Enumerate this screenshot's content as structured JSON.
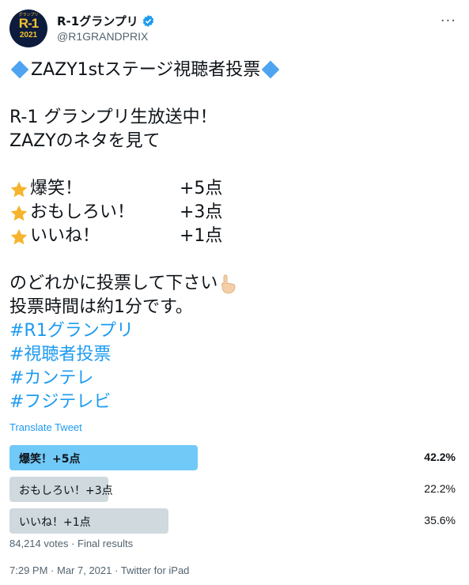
{
  "user": {
    "display_name": "R-1グランプリ",
    "handle": "@R1GRANDPRIX",
    "avatar_text": "R-1",
    "avatar_year": "2021",
    "avatar_top": "グランプリ"
  },
  "tweet": {
    "title": "ZAZY1stステージ視聴者投票",
    "line1": "R-1 グランプリ生放送中！",
    "line2": "ZAZYのネタを見て",
    "scores": [
      {
        "label": "爆笑！",
        "points": "+5点"
      },
      {
        "label": "おもしろい！",
        "points": "+3点"
      },
      {
        "label": "いいね！",
        "points": "+1点"
      }
    ],
    "line3": "のどれかに投票して下さい",
    "line4": "投票時間は約1分です。",
    "hashtags": [
      "#R1グランプリ",
      "#視聴者投票",
      "#カンテレ",
      "#フジテレビ"
    ]
  },
  "translate_label": "Translate Tweet",
  "poll": {
    "options": [
      {
        "label": "爆笑！+5点",
        "percent_text": "42.2%",
        "percent": 42.2,
        "winner": true
      },
      {
        "label": "おもしろい！+3点",
        "percent_text": "22.2%",
        "percent": 22.2,
        "winner": false
      },
      {
        "label": "いいね！+1点",
        "percent_text": "35.6%",
        "percent": 35.6,
        "winner": false
      }
    ],
    "summary": "84,214 votes · Final results"
  },
  "timestamp": {
    "time": "7:29 PM",
    "date": "Mar 7, 2021",
    "source": "Twitter for iPad"
  },
  "colors": {
    "accent": "#1d9bf0",
    "winner_bar": "#71c9f8",
    "other_bar": "#cfd9de",
    "diamond": "#4ea4f0",
    "star": "#f6b32c"
  },
  "icons": [
    "verified-badge-icon",
    "more-icon",
    "star-icon",
    "diamond-icon",
    "pointing-hand-icon"
  ]
}
